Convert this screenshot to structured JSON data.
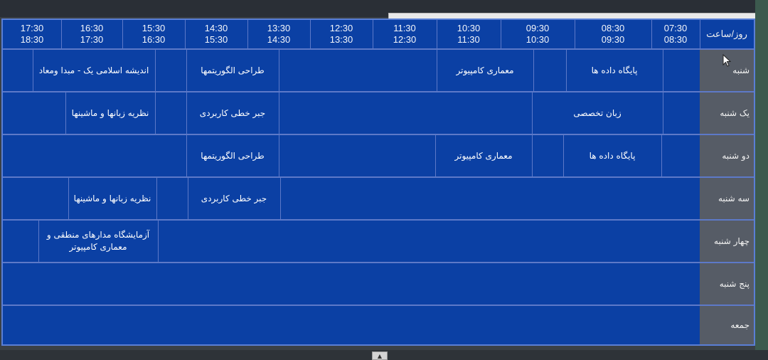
{
  "header": {
    "corner_label": "روز/ساعت",
    "time_slots": [
      {
        "start": "07:30",
        "end": "08:30"
      },
      {
        "start": "08:30",
        "end": "09:30"
      },
      {
        "start": "09:30",
        "end": "10:30"
      },
      {
        "start": "10:30",
        "end": "11:30"
      },
      {
        "start": "11:30",
        "end": "12:30"
      },
      {
        "start": "12:30",
        "end": "13:30"
      },
      {
        "start": "13:30",
        "end": "14:30"
      },
      {
        "start": "14:30",
        "end": "15:30"
      },
      {
        "start": "15:30",
        "end": "16:30"
      },
      {
        "start": "16:30",
        "end": "17:30"
      },
      {
        "start": "17:30",
        "end": "18:30"
      }
    ]
  },
  "days": [
    "شنبه",
    "یک شنبه",
    "دو شنبه",
    "سه شنبه",
    "چهار شنبه",
    "پنج شنبه",
    "جمعه"
  ],
  "courses": {
    "sat_db": "پایگاه داده ها",
    "sat_arch": "معماری کامپیوتر",
    "sat_algo": "طراحی الگوریتمها",
    "sat_islamic": "اندیشه اسلامی یک - مبدا ومعاد",
    "sun_tech_lang": "زبان تخصصی",
    "sun_linear": "جبر خطی کاربردی",
    "sun_theory": "نظریه زبانها و ماشینها",
    "mon_db": "پایگاه داده ها",
    "mon_arch": "معماری کامپیوتر",
    "mon_algo": "طراحی الگوریتمها",
    "tue_linear": "جبر خطی کاربردی",
    "tue_theory": "نظریه زبانها و ماشینها",
    "wed_lab": "آزمایشگاه مدارهای منطقی و معماری کامپیوتر"
  },
  "colors": {
    "grid_bg": "#0b40a4",
    "day_column": "#565c66",
    "grid_lines": "#5d79c8"
  }
}
